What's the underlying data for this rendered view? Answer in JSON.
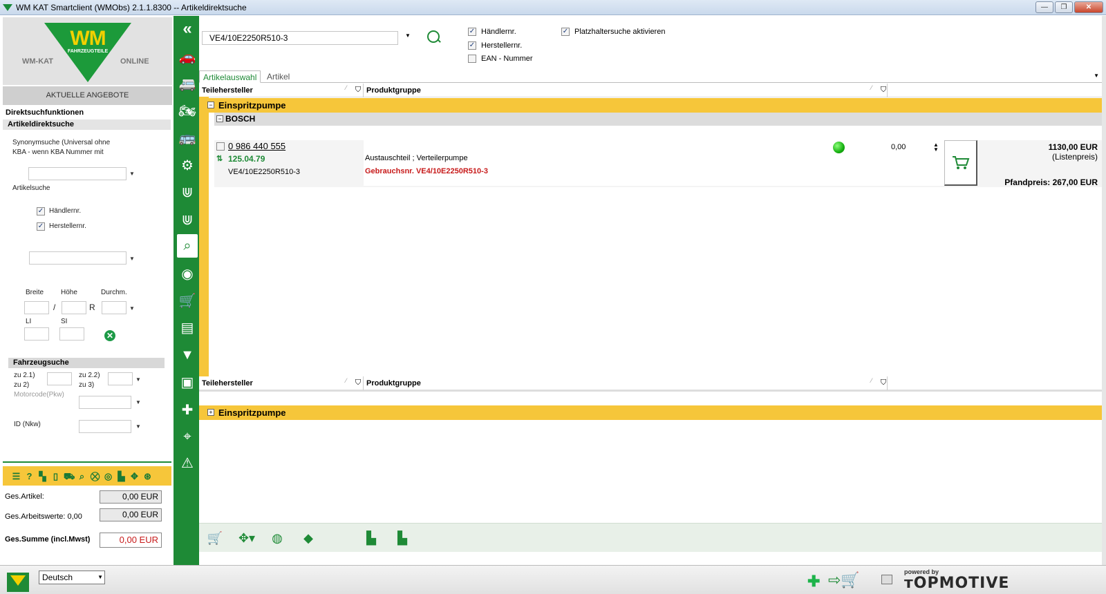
{
  "window": {
    "title": "WM KAT Smartclient (WMObs) 2.1.1.8300   --   Artikeldirektsuche"
  },
  "logo": {
    "brand": "WM",
    "sub": "FAHRZEUGTEILE",
    "left": "WM-KAT",
    "right": "ONLINE"
  },
  "left": {
    "angebote": "AKTUELLE ANGEBOTE",
    "direktsuch": "Direktsuchfunktionen",
    "artikeldirekt": "Artikeldirektsuche",
    "synonym_line1": "Synonymsuche  (Universal ohne",
    "synonym_line2": "KBA - wenn KBA Nummer mit",
    "artikelsuche": "Artikelsuche",
    "cb_haendler": "Händlernr.",
    "cb_hersteller": "Herstellernr.",
    "breite": "Breite",
    "hoehe": "Höhe",
    "durchm": "Durchm.",
    "slash": "/",
    "r": "R",
    "li": "LI",
    "si": "SI",
    "fahrzeugsuche": "Fahrzeugsuche",
    "zu21": "zu 2.1)",
    "zu2": "zu 2)",
    "zu22": "zu 2.2)",
    "zu3": "zu 3)",
    "motorcode": "Motorcode(Pkw)",
    "id_nkw": "ID (Nkw)"
  },
  "summary": {
    "ges_artikel_label": "Ges.Artikel:",
    "ges_artikel_value": "0,00 EUR",
    "ges_arbeit_label": "Ges.Arbeitswerte: 0,00",
    "ges_arbeit_value": "0,00 EUR",
    "ges_summe_label": "Ges.Summe (incl.Mwst)",
    "ges_summe_value": "0,00 EUR"
  },
  "search": {
    "value": "VE4/10E2250R510-3",
    "opt_haendler": "Händlernr.",
    "opt_hersteller": "Herstellernr.",
    "opt_ean": "EAN - Nummer",
    "opt_platzhalter": "Platzhaltersuche aktivieren"
  },
  "tabs": {
    "artikelauswahl": "Artikelauswahl",
    "artikel": "Artikel"
  },
  "grid": {
    "col_hersteller": "Teilehersteller",
    "col_produktgruppe": "Produktgruppe",
    "group": "Einspritzpumpe",
    "brand": "BOSCH",
    "article": {
      "number": "0 986 440 555",
      "id": "125.04.79",
      "ref": "VE4/10E2250R510-3",
      "desc": "Austauschteil ; Verteilerpumpe",
      "gebr": "Gebrauchsnr. VE4/10E2250R510-3",
      "qty": "0,00",
      "price": "1130,00 EUR",
      "price_sub": "(Listenpreis)",
      "pfand": "Pfandpreis: 267,00 EUR",
      "status_color": "#16b010"
    },
    "bottom_group": "Einspritzpumpe"
  },
  "statusbar": {
    "language": "Deutsch",
    "powered": "powered by",
    "topmotive": "ᴛOPMOTIVE"
  },
  "colors": {
    "accent": "#1e8a36",
    "group_yellow": "#f6c63a",
    "price_red": "#c71a1a"
  }
}
